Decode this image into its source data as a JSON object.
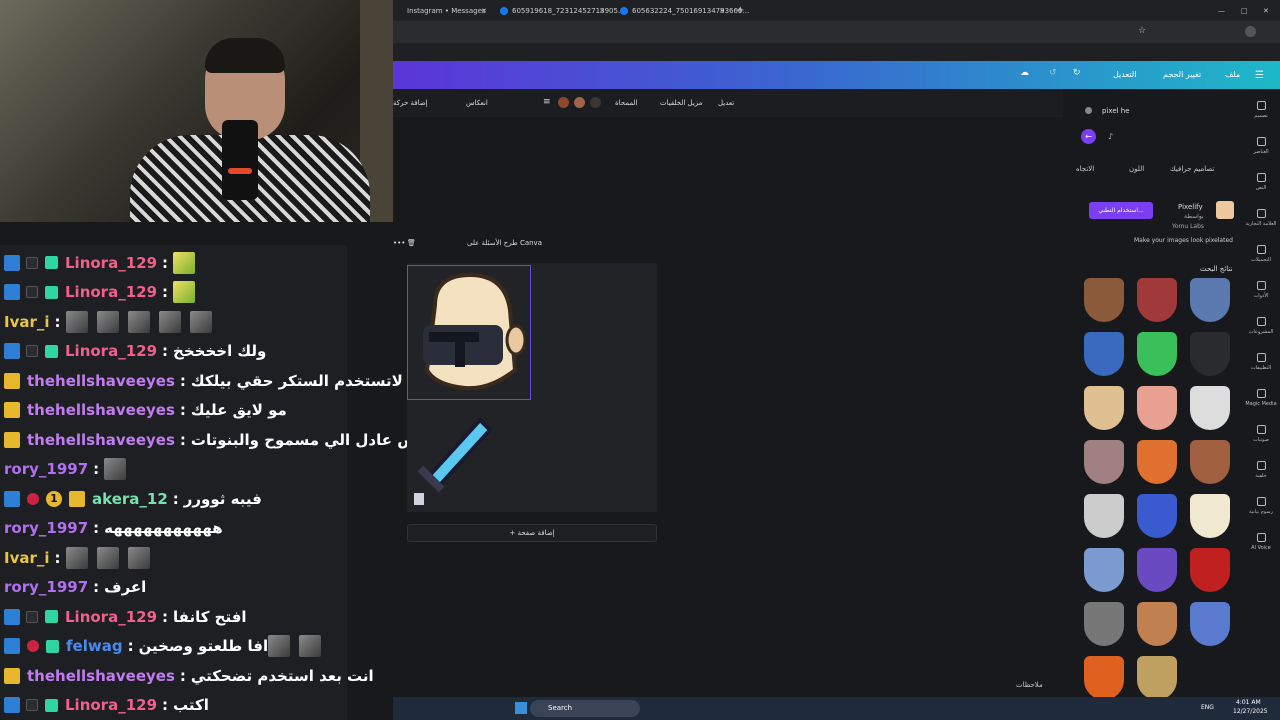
{
  "browser": {
    "tabs": [
      {
        "label": "Instagram • Messages"
      },
      {
        "label": "605919618_72312452713905…"
      },
      {
        "label": "605632224_750169134793660…"
      }
    ]
  },
  "canva_header": {
    "file": "ملف",
    "resize": "تغيير الحجم",
    "edit": "التعديل"
  },
  "edit_toolbar": {
    "edit": "تعديل",
    "bg_remover": "مزيل الخلفيات",
    "eraser": "الممحاة",
    "flip": "انعكاس",
    "add_motion": "إضافة حركة",
    "colors": [
      "#8a4a2e",
      "#a0644a",
      "#3a3432"
    ]
  },
  "canvas": {
    "ask_canva": "طرح الأسئلة على Canva",
    "add_page": "+ إضافة صفحة"
  },
  "search_panel": {
    "query": "pixel he",
    "filter_graphics": "تصاميم جرافيك",
    "filter_color": "اللون",
    "filter_orientation": "الاتجاه",
    "app_name": "Pixelify",
    "app_by": "بواسطة",
    "app_vendor": "Yomu Labs",
    "app_use_button": "استخدام التطبي...",
    "app_desc": "Make your images look pixelated",
    "results_title": "نتائج البحث",
    "notes": "ملاحظات"
  },
  "rail": [
    {
      "label": "تصميم"
    },
    {
      "label": "العناصر"
    },
    {
      "label": "النص"
    },
    {
      "label": "العلامة التجارية"
    },
    {
      "label": "التحميلات"
    },
    {
      "label": "الأدوات"
    },
    {
      "label": "المشروعات"
    },
    {
      "label": "التطبيقات"
    },
    {
      "label": "Magic Media"
    },
    {
      "label": "صوتيات"
    },
    {
      "label": "خلفية"
    },
    {
      "label": "رسوم بيانية"
    },
    {
      "label": "AI Voice"
    }
  ],
  "chat": [
    {
      "user": "Linora_129",
      "color": "#f0608a",
      "badges": [
        "blue",
        "gray",
        "green"
      ],
      "msg": "",
      "emotes": 1,
      "emote_type": "y"
    },
    {
      "user": "Linora_129",
      "color": "#f0608a",
      "badges": [
        "blue",
        "gray",
        "green"
      ],
      "msg": "",
      "emotes": 1,
      "emote_type": "y"
    },
    {
      "user": "Ivar_i",
      "color": "#e8c64a",
      "badges": [],
      "msg": "",
      "emotes": 5,
      "emote_type": "g"
    },
    {
      "user": "Linora_129",
      "color": "#f0608a",
      "badges": [
        "blue",
        "gray",
        "green"
      ],
      "msg": "ولك اخخخخخ",
      "emotes": 0
    },
    {
      "user": "thehellshaveeyes",
      "color": "#c07cf0",
      "badges": [
        "gold"
      ],
      "msg": "عمر لاتستخدم الستكر حقي بيلكك",
      "emotes": 0
    },
    {
      "user": "thehellshaveeyes",
      "color": "#c07cf0",
      "badges": [
        "gold"
      ],
      "msg": "مو لايق عليك",
      "emotes": 0
    },
    {
      "user": "thehellshaveeyes",
      "color": "#c07cf0",
      "badges": [
        "gold"
      ],
      "msg": "بس عادل الي مسموح والبنوتات",
      "emotes": 0
    },
    {
      "user": "rory_1997",
      "color": "#b070f0",
      "badges": [],
      "msg": "",
      "emotes": 1,
      "emote_type": "g"
    },
    {
      "user": "akera_12",
      "color": "#7ae0b0",
      "badges": [
        "blue",
        "red",
        "num",
        "gold"
      ],
      "msg": "فيبه ثوورر",
      "emotes": 0
    },
    {
      "user": "rory_1997",
      "color": "#b070f0",
      "badges": [],
      "msg": "هههههههههههه",
      "emotes": 0
    },
    {
      "user": "Ivar_i",
      "color": "#e8c64a",
      "badges": [],
      "msg": "",
      "emotes": 3,
      "emote_type": "g"
    },
    {
      "user": "rory_1997",
      "color": "#b070f0",
      "badges": [],
      "msg": "اعرف",
      "emotes": 0
    },
    {
      "user": "Linora_129",
      "color": "#f0608a",
      "badges": [
        "blue",
        "gray",
        "green"
      ],
      "msg": "افتح كانفا",
      "emotes": 0
    },
    {
      "user": "felwag",
      "color": "#4a8af0",
      "badges": [
        "blue",
        "red",
        "green"
      ],
      "msg": "افا طلعتو وصخين",
      "emotes": 2,
      "emote_type": "g"
    },
    {
      "user": "thehellshaveeyes",
      "color": "#c07cf0",
      "badges": [
        "gold"
      ],
      "msg": "انت بعد استخدم تضحكتي",
      "emotes": 0
    },
    {
      "user": "Linora_129",
      "color": "#f0608a",
      "badges": [
        "blue",
        "gray",
        "green"
      ],
      "msg": "اكتب",
      "emotes": 0
    }
  ],
  "taskbar": {
    "search": "Search",
    "lang": "ENG",
    "time": "4:01 AM",
    "date": "12/27/2025"
  }
}
